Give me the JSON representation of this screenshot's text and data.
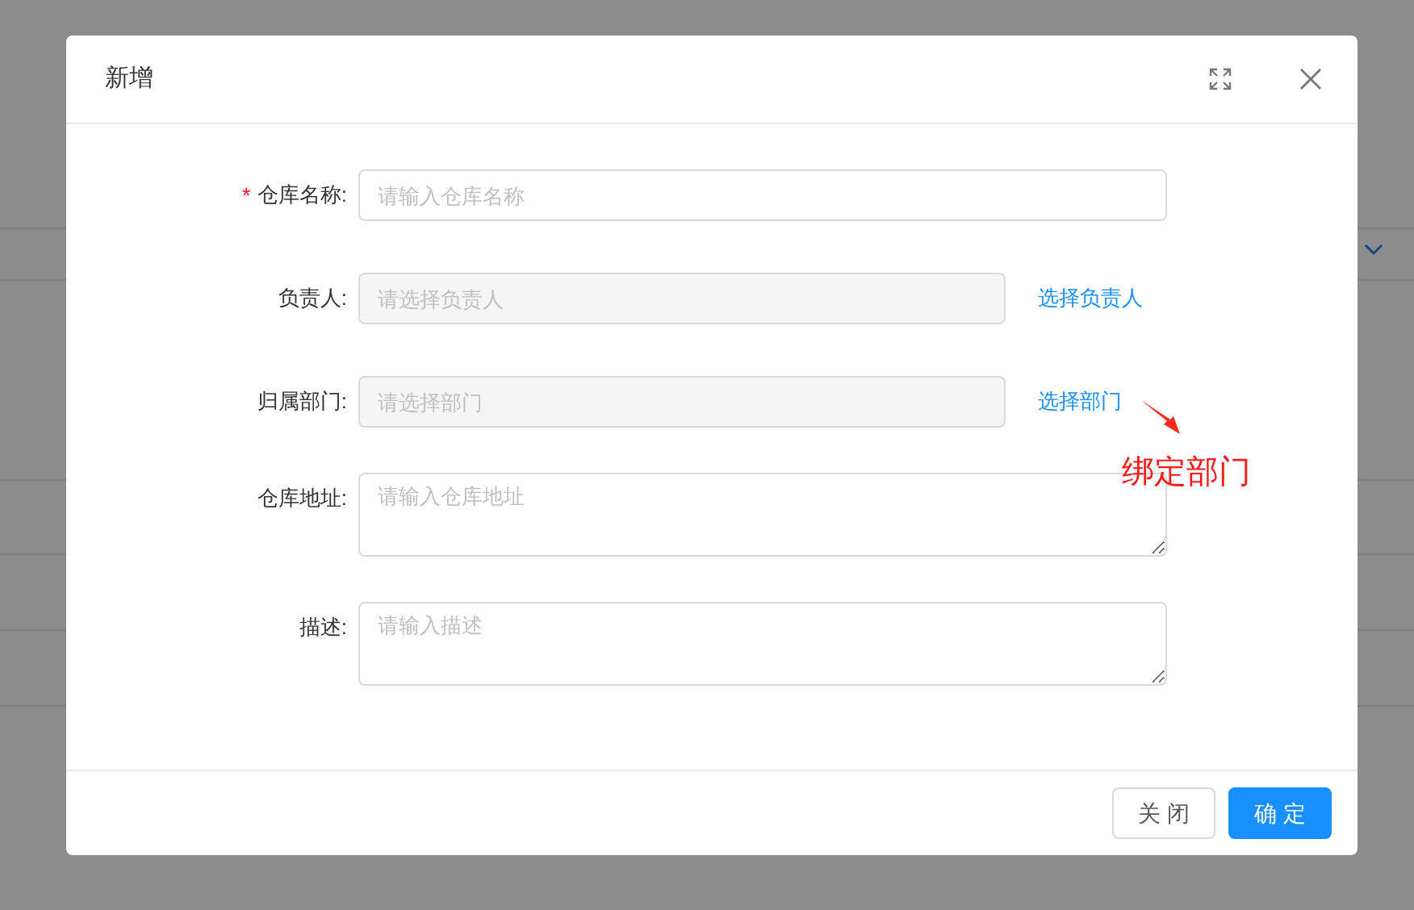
{
  "dialog": {
    "title": "新增",
    "fields": [
      {
        "kind": "input",
        "label": "仓库名称:",
        "required_mark": "*",
        "placeholder": "请输入仓库名称",
        "disabled": false
      },
      {
        "kind": "input",
        "label": "负责人:",
        "placeholder": "请选择负责人",
        "disabled": true,
        "link": "选择负责人"
      },
      {
        "kind": "input",
        "label": "归属部门:",
        "placeholder": "请选择部门",
        "disabled": true,
        "link": "选择部门"
      },
      {
        "kind": "textarea",
        "label": "仓库地址:",
        "placeholder": "请输入仓库地址"
      },
      {
        "kind": "textarea",
        "label": "描述:",
        "placeholder": "请输入描述"
      }
    ],
    "buttons": [
      {
        "label": "关 闭",
        "primary": false
      },
      {
        "label": "确 定",
        "primary": true
      }
    ]
  },
  "annotation": {
    "text": "绑定部门"
  }
}
